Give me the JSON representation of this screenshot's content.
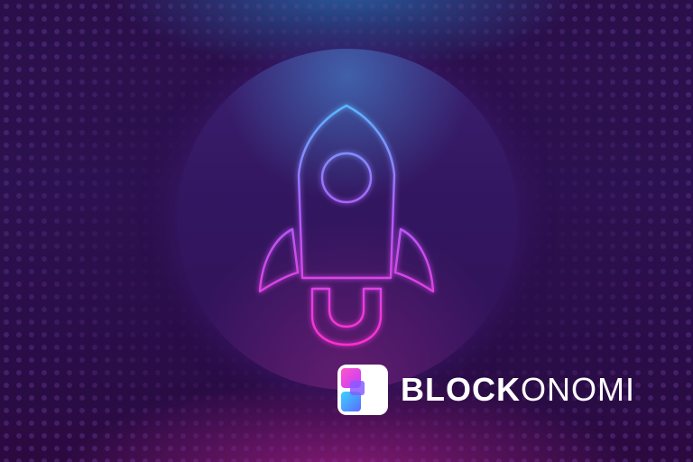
{
  "brand": {
    "name_bold": "BLOCK",
    "name_light": "ONOMI"
  },
  "icons": {
    "rocket": "rocket-outline-icon",
    "logo": "blockonomi-logo-icon"
  },
  "colors": {
    "background": "#2c1150",
    "neon_top": "#59b8ff",
    "neon_bottom": "#ff2fd2",
    "text": "#ffffff"
  }
}
